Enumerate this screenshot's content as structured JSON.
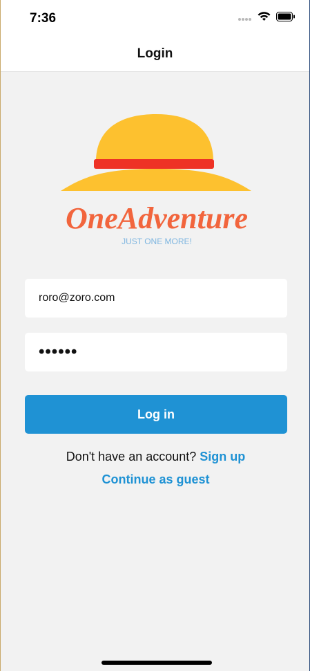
{
  "status_bar": {
    "time": "7:36",
    "icons": [
      "signal-dots-icon",
      "wifi-icon",
      "battery-icon"
    ]
  },
  "nav": {
    "title": "Login"
  },
  "logo": {
    "name": "OneAdventure",
    "tagline": "JUST ONE MORE!",
    "hat_colors": {
      "crown": "#fdc12f",
      "band": "#ee3225",
      "brim": "#fdc12f"
    },
    "text_color": "#f2653d",
    "tagline_color": "#7fb6e0"
  },
  "form": {
    "email_value": "roro@zoro.com",
    "password_mask": "••••••",
    "login_label": "Log in"
  },
  "footer": {
    "signup_prompt": "Don't have an account? ",
    "signup_link": "Sign up",
    "guest_link": "Continue as guest"
  },
  "colors": {
    "accent": "#1f92d4",
    "background": "#f2f2f2"
  }
}
